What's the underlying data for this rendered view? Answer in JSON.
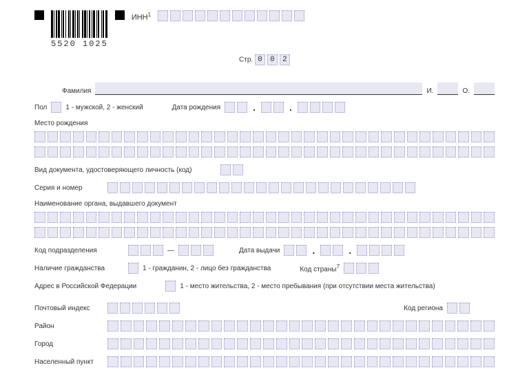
{
  "barcode_number": "5520 1025",
  "inn": {
    "label": "ИНН",
    "sup": "1"
  },
  "page": {
    "label": "Стр.",
    "value": [
      "0",
      "0",
      "2"
    ]
  },
  "name": {
    "surname_label": "Фамилия",
    "initial_i": "И.",
    "initial_o": "О."
  },
  "sex": {
    "label": "Пол",
    "hint": "1 - мужской, 2 - женский"
  },
  "birthdate": {
    "label": "Дата рождения"
  },
  "birthplace": {
    "label": "Место рождения"
  },
  "doctype": {
    "label": "Вид документа, удостоверяющего личность (код)"
  },
  "serial": {
    "label": "Серия и номер"
  },
  "issuer": {
    "label": "Наименование органа, выдавшего документ"
  },
  "deptcode": {
    "label": "Код подразделения",
    "sep": "—"
  },
  "issuedate": {
    "label": "Дата выдачи"
  },
  "citizenship": {
    "label": "Наличие гражданства",
    "hint": "1 - гражданин, 2 - лицо без гражданства"
  },
  "country": {
    "label": "Код страны",
    "sup": "7"
  },
  "address_rf": {
    "label": "Адрес в Российской Федерации",
    "hint": "1 - место жительства, 2 - место пребывания (при отсутствии места жительства)"
  },
  "postcode": {
    "label": "Почтовый индекс"
  },
  "region": {
    "label": "Код региона"
  },
  "district": {
    "label": "Район"
  },
  "city": {
    "label": "Город"
  },
  "settlement": {
    "label": "Населенный пункт"
  }
}
